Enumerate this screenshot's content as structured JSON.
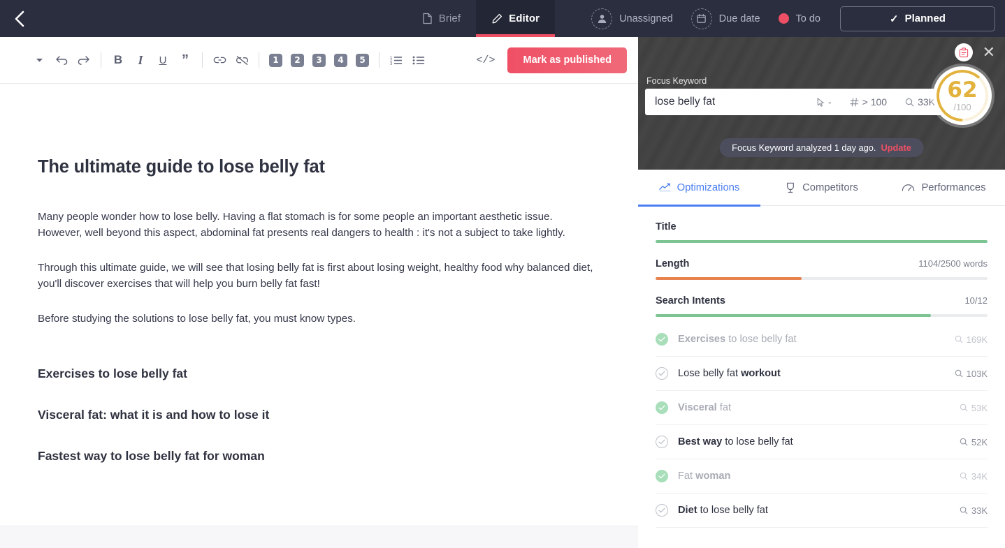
{
  "topbar": {
    "back_icon": "chevron-left-icon",
    "tabs": [
      {
        "label": "Brief",
        "icon": "document-icon",
        "active": false
      },
      {
        "label": "Editor",
        "icon": "pencil-icon",
        "active": true
      }
    ],
    "assignee": "Unassigned",
    "due_date": "Due date",
    "status": "To do",
    "planned_button": "Planned",
    "planned_check": "✓",
    "accent": "#ef4f64",
    "bg": "#2b2e3f"
  },
  "toolbar": {
    "dropdown_icon": "caret-down-icon",
    "undo_icon": "undo-icon",
    "redo_icon": "redo-icon",
    "bold": "B",
    "italic": "I",
    "underline": "U",
    "quote": "”",
    "link_icon": "link-icon",
    "unlink_icon": "unlink-icon",
    "headings": [
      "1",
      "2",
      "3",
      "4",
      "5"
    ],
    "ordered_list_icon": "ordered-list-icon",
    "bullet_list_icon": "bullet-list-icon",
    "code_label": "</>",
    "publish_label": "Mark as published",
    "publish_color": "#ef4f64"
  },
  "document": {
    "title": "The ultimate guide to lose belly fat",
    "paragraphs": [
      "Many people wonder how to lose belly. Having a flat stomach is for some people an important aesthetic issue. However, well beyond this aspect, abdominal fat presents real dangers to health : it's not a subject to take lightly.",
      "Through this ultimate guide, we will see that losing belly fat is first about losing weight, healthy food why balanced diet, you'll discover exercises that will help you burn belly fat fast!",
      "Before studying the solutions to lose belly fat, you must know types."
    ],
    "headings": [
      "Exercises to lose belly fat",
      "Visceral fat: what it is and how to lose it",
      "Fastest way to lose belly fat for woman"
    ]
  },
  "panel": {
    "clipboard_icon": "clipboard-icon",
    "close_icon": "close-icon",
    "focus_keyword_label": "Focus Keyword",
    "focus_keyword_value": "lose belly fat",
    "cursor_metric": "-",
    "cursor_icon": "cursor-icon",
    "rank_icon": "hash-icon",
    "rank_metric": "> 100",
    "volume_icon": "search-icon",
    "volume_metric": "33K",
    "score": "62",
    "score_denominator": "/100",
    "score_color": "#e3b23c",
    "analyzed_text": "Focus Keyword analyzed 1 day ago.",
    "analyzed_update": "Update",
    "tabs": [
      {
        "label": "Optimizations",
        "icon": "trend-line-icon",
        "active": true
      },
      {
        "label": "Competitors",
        "icon": "trophy-icon",
        "active": false
      },
      {
        "label": "Performances",
        "icon": "speedometer-icon",
        "active": false
      }
    ],
    "metrics": [
      {
        "name": "Title",
        "value": "",
        "percent": 100,
        "color": "#7cc593"
      },
      {
        "name": "Length",
        "value": "1104/2500 words",
        "percent": 44,
        "color": "#e8834f"
      },
      {
        "name": "Search Intents",
        "value": "10/12",
        "percent": 83,
        "color": "#7cc593"
      }
    ],
    "intents": [
      {
        "pre": "Exercises",
        "post": " to lose belly fat",
        "bold_first": true,
        "volume": "169K",
        "done": true
      },
      {
        "pre": "Lose belly fat ",
        "post": "workout",
        "bold_first": false,
        "volume": "103K",
        "done": false
      },
      {
        "pre": "Visceral",
        "post": " fat",
        "bold_first": true,
        "volume": "53K",
        "done": true
      },
      {
        "pre": "Best way",
        "post": " to lose belly fat",
        "bold_first": true,
        "volume": "52K",
        "done": false
      },
      {
        "pre": "Fat ",
        "post": "woman",
        "bold_first": false,
        "volume": "34K",
        "done": true
      },
      {
        "pre": "Diet",
        "post": " to lose belly fat",
        "bold_first": true,
        "volume": "33K",
        "done": false
      }
    ]
  }
}
